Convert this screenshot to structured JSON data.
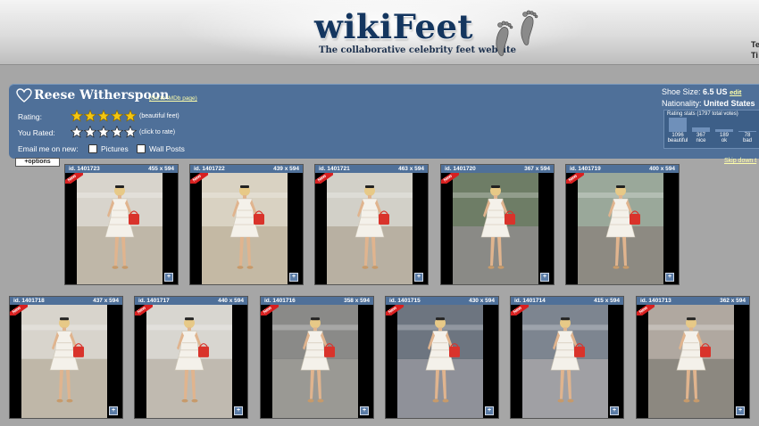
{
  "header": {
    "logo": "wikiFeet",
    "tagline": "The collaborative celebrity feet website",
    "corner_text": "Te Ti"
  },
  "celebrity": {
    "name": "Reese Witherspoon",
    "imdb_link": "(Go to IMDb page)",
    "rating_label": "Rating:",
    "rating_note": "(beautiful feet)",
    "rating_stars": 5,
    "you_rated_label": "You Rated:",
    "you_rated_note": "(click to rate)",
    "you_rated_stars": 0,
    "email_label": "Email me on new:",
    "email_pictures": "Pictures",
    "email_wall": "Wall Posts",
    "shoe_size_label": "Shoe Size:",
    "shoe_size_value": "6.5 US",
    "edit_label": "edit",
    "nationality_label": "Nationality:",
    "nationality_value": "United States",
    "rating_stats_title": "Rating stats (1797 total votes)",
    "rating_stats": [
      {
        "count": "1096",
        "label": "beautiful",
        "value": 1096
      },
      {
        "count": "367",
        "label": "nice",
        "value": 367
      },
      {
        "count": "189",
        "label": "ok",
        "value": 189
      },
      {
        "count": "78",
        "label": "bad",
        "value": 78
      }
    ]
  },
  "controls": {
    "options_label": "+options",
    "skip_label": "Skip down t"
  },
  "colors": {
    "panel": "#4f7099",
    "link": "#ffffaa",
    "new_badge": "#d82020",
    "background": "#a6a6a6"
  },
  "thumbnails": [
    {
      "id": "id. 1401723",
      "size": "455 x 594",
      "is_new": true
    },
    {
      "id": "id. 1401722",
      "size": "439 x 594",
      "is_new": true
    },
    {
      "id": "id. 1401721",
      "size": "463 x 594",
      "is_new": true
    },
    {
      "id": "id. 1401720",
      "size": "367 x 594",
      "is_new": true
    },
    {
      "id": "id. 1401719",
      "size": "400 x 594",
      "is_new": true
    },
    {
      "id": "id. 1401718",
      "size": "437 x 594",
      "is_new": true
    },
    {
      "id": "id. 1401717",
      "size": "440 x 594",
      "is_new": true
    },
    {
      "id": "id. 1401716",
      "size": "358 x 594",
      "is_new": true
    },
    {
      "id": "id. 1401715",
      "size": "430 x 594",
      "is_new": true
    },
    {
      "id": "id. 1401714",
      "size": "415 x 594",
      "is_new": true
    },
    {
      "id": "id. 1401713",
      "size": "362 x 594",
      "is_new": true
    }
  ]
}
